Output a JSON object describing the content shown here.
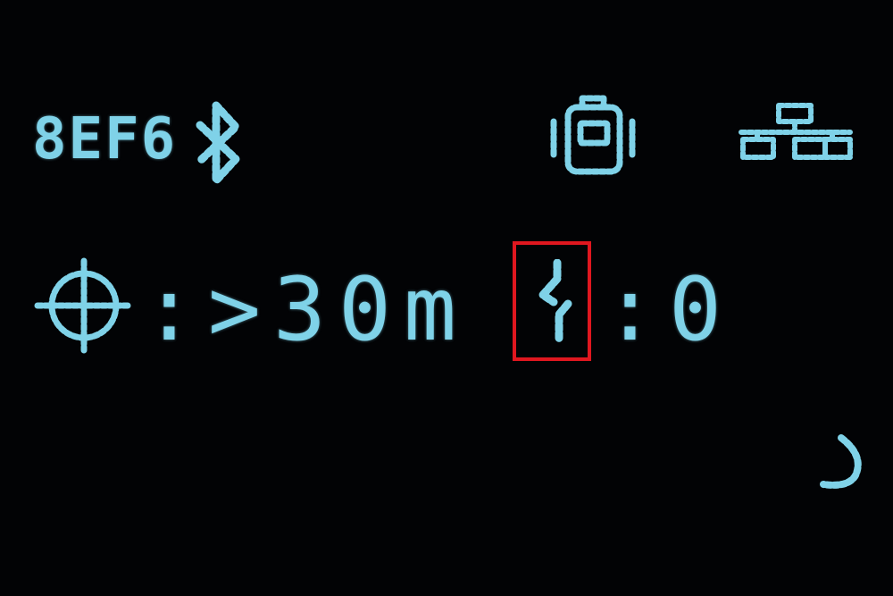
{
  "header": {
    "device_id": "8EF6",
    "icons": [
      "bluetooth-icon",
      "device-icon",
      "network-icon"
    ]
  },
  "status": {
    "accuracy": ":>30m",
    "count": ":0"
  },
  "indicators": {
    "crosshair": "crosshair-icon",
    "count": "lightning-icon",
    "sleep": "moon-icon"
  },
  "colors": {
    "display_text": "#7fd2e8",
    "background": "#020305",
    "highlight_box": "#e0171f"
  }
}
